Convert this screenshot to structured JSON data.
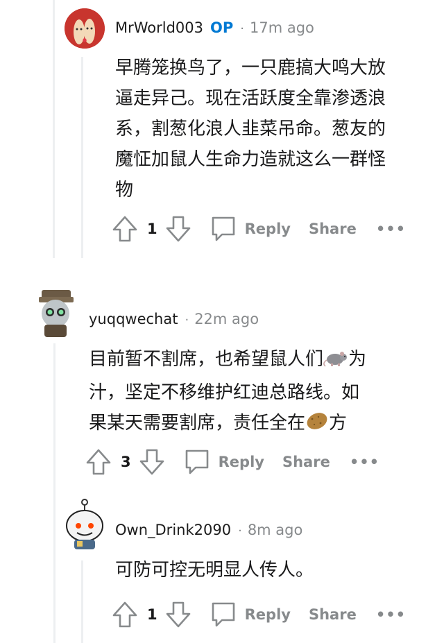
{
  "comments": [
    {
      "username": "MrWorld003",
      "op_badge": "OP",
      "time": "17m ago",
      "body_lines": [
        "早腾笼换鸟了，一只鹿搞大鸣大放",
        "逼走异己。现在活跃度全靠渗透浪",
        "系，割葱化浪人韭菜吊命。葱友的",
        "魔怔加鼠人生命力造就这么一群怪",
        "物"
      ],
      "score": "1",
      "reply_label": "Reply",
      "share_label": "Share",
      "more_label": "•••"
    },
    {
      "username": "yuqqwechat",
      "time": "22m ago",
      "body_lines": [
        "目前暂不割席，也希望鼠人们",
        "为",
        "汁，坚定不移维护红迪总路线。如",
        "果某天需要割席，责任全在",
        "方"
      ],
      "score": "3",
      "reply_label": "Reply",
      "share_label": "Share",
      "more_label": "•••"
    },
    {
      "username": "Own_Drink2090",
      "time": "8m ago",
      "body_lines": [
        "可防可控无明显人传人。"
      ],
      "score": "1",
      "reply_label": "Reply",
      "share_label": "Share",
      "more_label": "•••"
    }
  ],
  "icons": {
    "upvote": "upvote-arrow-icon",
    "downvote": "downvote-arrow-icon",
    "reply": "reply-bubble-icon",
    "more": "more-dots-icon",
    "rat_emoji": "rat-emoji-icon",
    "potato_emoji": "potato-emoji-icon"
  },
  "colors": {
    "op_badge": "#0079d3",
    "meta_gray": "#878a8c",
    "thread_line": "#edeff1",
    "text": "#1a1a1b"
  }
}
